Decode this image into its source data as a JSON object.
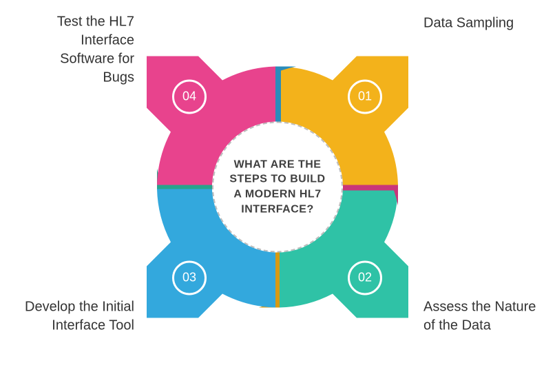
{
  "center_title": "WHAT ARE THE STEPS TO BUILD A MODERN HL7 INTERFACE?",
  "colors": {
    "q1": "#f3b21b",
    "q1_dark": "#d79a14",
    "q2": "#2fc2a6",
    "q2_dark": "#27a38c",
    "q3": "#33a8dd",
    "q3_dark": "#2a8cbb",
    "q4": "#e8438d",
    "q4_dark": "#c93679"
  },
  "steps": [
    {
      "num": "01",
      "label": "Data Sampling"
    },
    {
      "num": "02",
      "label": "Assess the Nature of the Data"
    },
    {
      "num": "03",
      "label": "Develop the Initial Interface Tool"
    },
    {
      "num": "04",
      "label": "Test the HL7 Interface Software for Bugs"
    }
  ]
}
